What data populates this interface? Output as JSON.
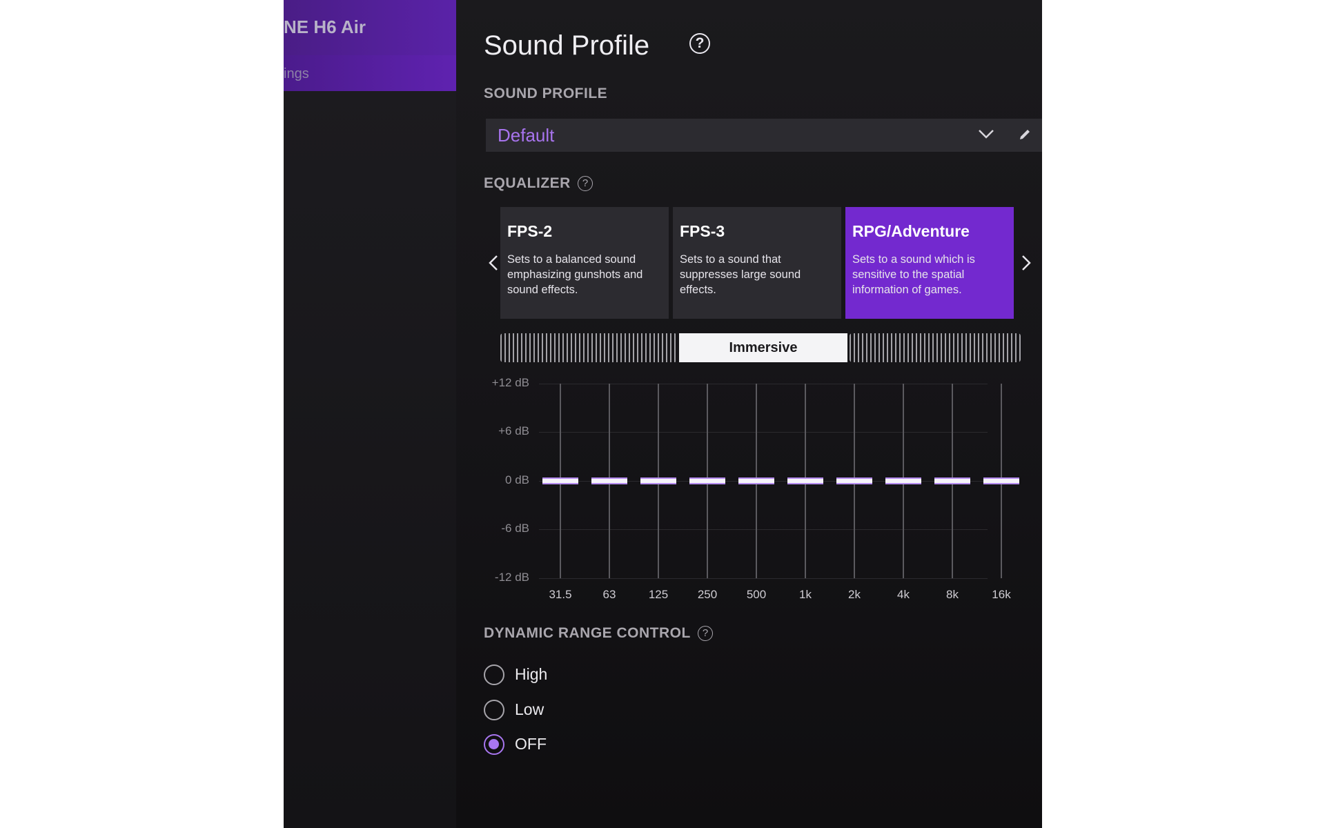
{
  "sidebar": {
    "device_title": "NE H6 Air",
    "sub_item": "ings"
  },
  "page": {
    "title": "Sound Profile",
    "help_icon": "question-circle-icon"
  },
  "sound_profile": {
    "label": "SOUND PROFILE",
    "selected": "Default",
    "dropdown_icon": "chevron-down-icon",
    "edit_icon": "pencil-icon"
  },
  "equalizer": {
    "label": "EQUALIZER",
    "presets": [
      {
        "name": "FPS-2",
        "description": "Sets to a balanced sound emphasizing gunshots and sound effects.",
        "selected": false
      },
      {
        "name": "FPS-3",
        "description": "Sets to a sound that suppresses large sound effects.",
        "selected": false
      },
      {
        "name": "RPG/Adventure",
        "description": "Sets to a sound which is sensitive to the spatial information of games.",
        "selected": true
      }
    ],
    "prev_icon": "chevron-left-icon",
    "next_icon": "chevron-right-icon",
    "spatial_mode": "Immersive",
    "db_scale": [
      "+12 dB",
      "+6 dB",
      "0 dB",
      "-6 dB",
      "-12 dB"
    ],
    "bands": [
      {
        "freq": "31.5",
        "gain_db": 0
      },
      {
        "freq": "63",
        "gain_db": 0
      },
      {
        "freq": "125",
        "gain_db": 0
      },
      {
        "freq": "250",
        "gain_db": 0
      },
      {
        "freq": "500",
        "gain_db": 0
      },
      {
        "freq": "1k",
        "gain_db": 0
      },
      {
        "freq": "2k",
        "gain_db": 0
      },
      {
        "freq": "4k",
        "gain_db": 0
      },
      {
        "freq": "8k",
        "gain_db": 0
      },
      {
        "freq": "16k",
        "gain_db": 0
      }
    ]
  },
  "dynamic_range_control": {
    "label": "DYNAMIC RANGE CONTROL",
    "options": [
      {
        "label": "High",
        "checked": false
      },
      {
        "label": "Low",
        "checked": false
      },
      {
        "label": "OFF",
        "checked": true
      }
    ]
  },
  "colors": {
    "accent": "#7329cf",
    "accent_light": "#a876f0",
    "background": "#141316",
    "card": "#2c2b30"
  }
}
